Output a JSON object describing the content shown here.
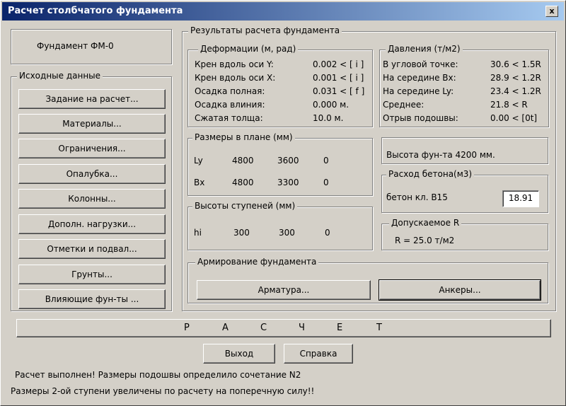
{
  "window": {
    "title": "Расчет столбчатого фундамента",
    "close": "x"
  },
  "foundation_name": "Фундамент ФМ-0",
  "initial": {
    "legend": "Исходные данные",
    "buttons": [
      "Задание на расчет...",
      "Материалы...",
      "Ограничения...",
      "Опалубка...",
      "Колонны...",
      "Дополн. нагрузки...",
      "Отметки и подвал...",
      "Грунты...",
      "Влияющие фун-ты ..."
    ]
  },
  "results": {
    "legend": "Результаты расчета фундамента",
    "deform": {
      "legend": "Деформации  (м, рад)",
      "rows": [
        {
          "label": "Крен вдоль оси Y:",
          "value": "0.002 < [  i  ]"
        },
        {
          "label": "Крен вдоль оси X:",
          "value": "0.001 < [  i  ]"
        },
        {
          "label": "Осадка полная:",
          "value": "0.031 < [  f  ]"
        },
        {
          "label": "Осадка влиния:",
          "value": "0.000 м."
        },
        {
          "label": "Сжатая толща:",
          "value": "10.0 м."
        }
      ]
    },
    "pressure": {
      "legend": "Давления (т/м2)",
      "rows": [
        {
          "label": "В угловой точке:",
          "value": "30.6 < 1.5R"
        },
        {
          "label": "На середине Bx:",
          "value": "28.9 < 1.2R"
        },
        {
          "label": "На середине Ly:",
          "value": "23.4 < 1.2R"
        },
        {
          "label": "Среднее:",
          "value": "21.8 <   R"
        },
        {
          "label": "Отрыв подошвы:",
          "value": "0.00 < [0t]"
        }
      ]
    },
    "plan": {
      "legend": "Размеры в плане (мм)",
      "rows": [
        {
          "label": "Ly",
          "v1": "4800",
          "v2": "3600",
          "v3": "0"
        },
        {
          "label": "Bx",
          "v1": "4800",
          "v2": "3300",
          "v3": "0"
        }
      ]
    },
    "steps": {
      "legend": "Высоты ступеней (мм)",
      "row": {
        "label": "hi",
        "v1": "300",
        "v2": "300",
        "v3": "0"
      }
    },
    "height": "Высота фун-та  4200 мм.",
    "concrete": {
      "legend": "Расход бетона(м3)",
      "label": "бетон кл. B15",
      "value": "18.91"
    },
    "allowed": {
      "legend": "Допускаемое  R",
      "value": "R  =  25.0 т/м2"
    },
    "reinf": {
      "legend": "Армирование фундамента",
      "rebar": "Арматура...",
      "anchors": "Анкеры..."
    }
  },
  "raschet_letters": [
    "Р",
    "А",
    "С",
    "Ч",
    "Е",
    "Т"
  ],
  "exit": "Выход",
  "help": "Справка",
  "status1": "Расчет выполнен! Размеры подошвы определило сочетание  N2",
  "status2": "Размеры 2-ой ступени увеличены по расчету на поперечную силу!!"
}
